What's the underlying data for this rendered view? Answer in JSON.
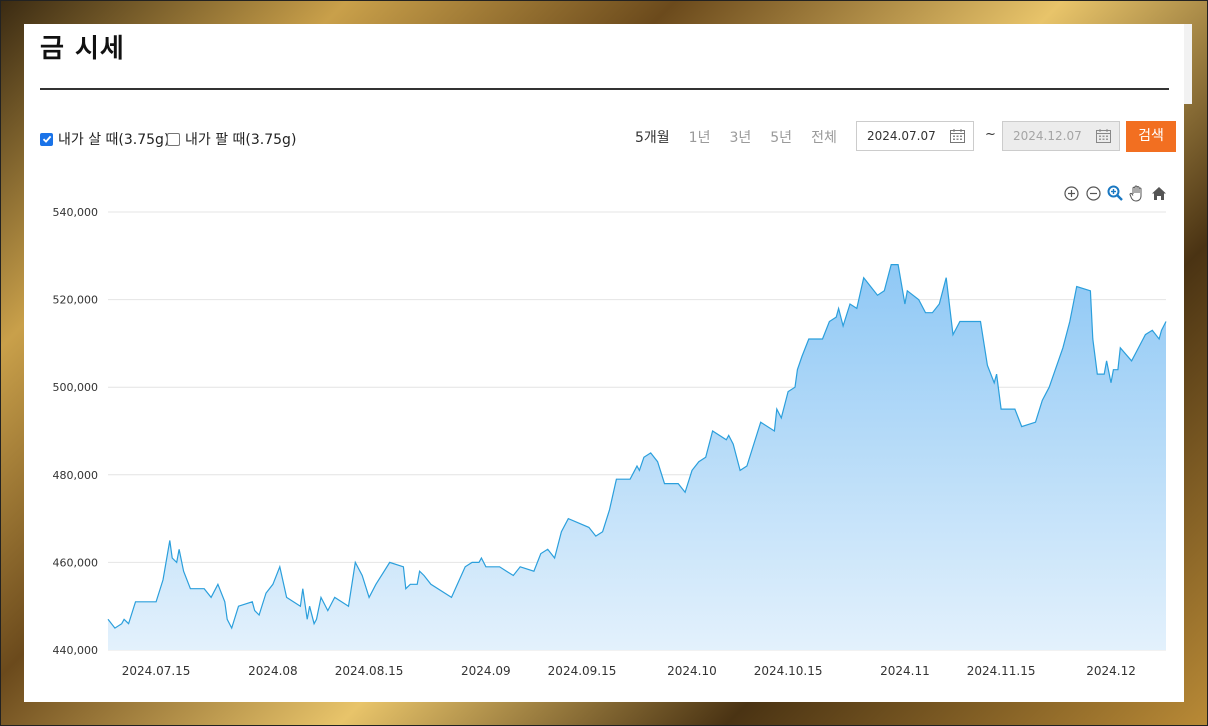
{
  "page": {
    "title": "금 시세"
  },
  "filters": {
    "buy_label": "내가 살 때(3.75g)",
    "buy_checked": true,
    "sell_label": "내가 팔 때(3.75g)",
    "sell_checked": false
  },
  "periods": [
    "5개월",
    "1년",
    "3년",
    "5년",
    "전체"
  ],
  "active_period": "5개월",
  "date_from": "2024.07.07",
  "date_sep": "~",
  "date_to": "2024.12.07",
  "search_label": "검색",
  "toolbar_icons": [
    "zoom-in-icon",
    "zoom-out-icon",
    "magnifier-zoom-icon",
    "pan-hand-icon",
    "home-reset-icon"
  ],
  "colors": {
    "accent": "#f26f21",
    "line": "#2b9fdc",
    "area_top": "#8fc8f5",
    "area_bottom": "#e3f1fc"
  },
  "chart_data": {
    "type": "area",
    "ylim": [
      440000,
      540000
    ],
    "yticks": [
      440000,
      460000,
      480000,
      500000,
      520000,
      540000
    ],
    "ytick_labels": [
      "440,000",
      "460,000",
      "480,000",
      "500,000",
      "520,000",
      "540,000"
    ],
    "xlim": [
      "2024-07-08",
      "2024-12-09"
    ],
    "xticks": [
      "2024-07-15",
      "2024-08-01",
      "2024-08-15",
      "2024-09-01",
      "2024-09-15",
      "2024-10-01",
      "2024-10-15",
      "2024-11-01",
      "2024-11-15",
      "2024-12-01"
    ],
    "xtick_labels": [
      "2024.07.15",
      "2024.08",
      "2024.08.15",
      "2024.09",
      "2024.09.15",
      "2024.10",
      "2024.10.15",
      "2024.11",
      "2024.11.15",
      "2024.12"
    ],
    "grid": true,
    "series": [
      {
        "points": [
          [
            "2024-07-08",
            447000
          ],
          [
            "2024-07-09",
            445000
          ],
          [
            "2024-07-10",
            446000
          ],
          [
            "2024-07-10",
            447000
          ],
          [
            "2024-07-11",
            446000
          ],
          [
            "2024-07-12",
            451000
          ],
          [
            "2024-07-15",
            451000
          ],
          [
            "2024-07-16",
            456000
          ],
          [
            "2024-07-17",
            465000
          ],
          [
            "2024-07-17",
            461000
          ],
          [
            "2024-07-18",
            460000
          ],
          [
            "2024-07-18",
            463000
          ],
          [
            "2024-07-19",
            458000
          ],
          [
            "2024-07-20",
            454000
          ],
          [
            "2024-07-22",
            454000
          ],
          [
            "2024-07-23",
            452000
          ],
          [
            "2024-07-24",
            455000
          ],
          [
            "2024-07-25",
            451000
          ],
          [
            "2024-07-25",
            447000
          ],
          [
            "2024-07-26",
            445000
          ],
          [
            "2024-07-27",
            450000
          ],
          [
            "2024-07-29",
            451000
          ],
          [
            "2024-07-29",
            449000
          ],
          [
            "2024-07-30",
            448000
          ],
          [
            "2024-07-31",
            453000
          ],
          [
            "2024-08-01",
            455000
          ],
          [
            "2024-08-02",
            459000
          ],
          [
            "2024-08-03",
            452000
          ],
          [
            "2024-08-05",
            450000
          ],
          [
            "2024-08-05",
            454000
          ],
          [
            "2024-08-06",
            447000
          ],
          [
            "2024-08-06",
            450000
          ],
          [
            "2024-08-07",
            446000
          ],
          [
            "2024-08-07",
            447000
          ],
          [
            "2024-08-08",
            452000
          ],
          [
            "2024-08-09",
            449000
          ],
          [
            "2024-08-10",
            452000
          ],
          [
            "2024-08-12",
            450000
          ],
          [
            "2024-08-13",
            460000
          ],
          [
            "2024-08-14",
            457000
          ],
          [
            "2024-08-15",
            452000
          ],
          [
            "2024-08-16",
            455000
          ],
          [
            "2024-08-18",
            460000
          ],
          [
            "2024-08-20",
            459000
          ],
          [
            "2024-08-20",
            454000
          ],
          [
            "2024-08-21",
            455000
          ],
          [
            "2024-08-22",
            455000
          ],
          [
            "2024-08-22",
            458000
          ],
          [
            "2024-08-23",
            457000
          ],
          [
            "2024-08-24",
            455000
          ],
          [
            "2024-08-27",
            452000
          ],
          [
            "2024-08-29",
            459000
          ],
          [
            "2024-08-30",
            460000
          ],
          [
            "2024-08-31",
            460000
          ],
          [
            "2024-08-31",
            461000
          ],
          [
            "2024-09-01",
            459000
          ],
          [
            "2024-09-03",
            459000
          ],
          [
            "2024-09-04",
            458000
          ],
          [
            "2024-09-05",
            457000
          ],
          [
            "2024-09-06",
            459000
          ],
          [
            "2024-09-08",
            458000
          ],
          [
            "2024-09-09",
            462000
          ],
          [
            "2024-09-10",
            463000
          ],
          [
            "2024-09-11",
            461000
          ],
          [
            "2024-09-12",
            467000
          ],
          [
            "2024-09-13",
            470000
          ],
          [
            "2024-09-16",
            468000
          ],
          [
            "2024-09-17",
            466000
          ],
          [
            "2024-09-18",
            467000
          ],
          [
            "2024-09-19",
            472000
          ],
          [
            "2024-09-20",
            479000
          ],
          [
            "2024-09-22",
            479000
          ],
          [
            "2024-09-23",
            482000
          ],
          [
            "2024-09-23",
            481000
          ],
          [
            "2024-09-24",
            484000
          ],
          [
            "2024-09-25",
            485000
          ],
          [
            "2024-09-26",
            483000
          ],
          [
            "2024-09-27",
            478000
          ],
          [
            "2024-09-29",
            478000
          ],
          [
            "2024-09-30",
            476000
          ],
          [
            "2024-10-01",
            481000
          ],
          [
            "2024-10-02",
            483000
          ],
          [
            "2024-10-03",
            484000
          ],
          [
            "2024-10-04",
            490000
          ],
          [
            "2024-10-06",
            488000
          ],
          [
            "2024-10-06",
            489000
          ],
          [
            "2024-10-07",
            487000
          ],
          [
            "2024-10-08",
            481000
          ],
          [
            "2024-10-09",
            482000
          ],
          [
            "2024-10-11",
            492000
          ],
          [
            "2024-10-13",
            490000
          ],
          [
            "2024-10-13",
            495000
          ],
          [
            "2024-10-14",
            493000
          ],
          [
            "2024-10-15",
            499000
          ],
          [
            "2024-10-16",
            500000
          ],
          [
            "2024-10-16",
            504000
          ],
          [
            "2024-10-17",
            507000
          ],
          [
            "2024-10-18",
            511000
          ],
          [
            "2024-10-20",
            511000
          ],
          [
            "2024-10-21",
            515000
          ],
          [
            "2024-10-22",
            516000
          ],
          [
            "2024-10-22",
            518000
          ],
          [
            "2024-10-23",
            514000
          ],
          [
            "2024-10-24",
            519000
          ],
          [
            "2024-10-25",
            518000
          ],
          [
            "2024-10-26",
            525000
          ],
          [
            "2024-10-28",
            521000
          ],
          [
            "2024-10-29",
            522000
          ],
          [
            "2024-10-30",
            528000
          ],
          [
            "2024-10-31",
            528000
          ],
          [
            "2024-11-01",
            519000
          ],
          [
            "2024-11-01",
            522000
          ],
          [
            "2024-11-03",
            520000
          ],
          [
            "2024-11-04",
            517000
          ],
          [
            "2024-11-05",
            517000
          ],
          [
            "2024-11-06",
            519000
          ],
          [
            "2024-11-07",
            525000
          ],
          [
            "2024-11-08",
            512000
          ],
          [
            "2024-11-09",
            515000
          ],
          [
            "2024-11-12",
            515000
          ],
          [
            "2024-11-13",
            505000
          ],
          [
            "2024-11-14",
            501000
          ],
          [
            "2024-11-14",
            503000
          ],
          [
            "2024-11-15",
            495000
          ],
          [
            "2024-11-17",
            495000
          ],
          [
            "2024-11-18",
            491000
          ],
          [
            "2024-11-20",
            492000
          ],
          [
            "2024-11-21",
            497000
          ],
          [
            "2024-11-22",
            500000
          ],
          [
            "2024-11-24",
            509000
          ],
          [
            "2024-11-25",
            515000
          ],
          [
            "2024-11-26",
            523000
          ],
          [
            "2024-11-28",
            522000
          ],
          [
            "2024-11-28",
            511000
          ],
          [
            "2024-11-29",
            503000
          ],
          [
            "2024-11-30",
            503000
          ],
          [
            "2024-11-30",
            506000
          ],
          [
            "2024-12-01",
            501000
          ],
          [
            "2024-12-01",
            504000
          ],
          [
            "2024-12-02",
            504000
          ],
          [
            "2024-12-02",
            509000
          ],
          [
            "2024-12-04",
            506000
          ],
          [
            "2024-12-06",
            512000
          ],
          [
            "2024-12-07",
            513000
          ],
          [
            "2024-12-08",
            511000
          ],
          [
            "2024-12-08",
            513000
          ],
          [
            "2024-12-09",
            515000
          ]
        ]
      }
    ]
  }
}
